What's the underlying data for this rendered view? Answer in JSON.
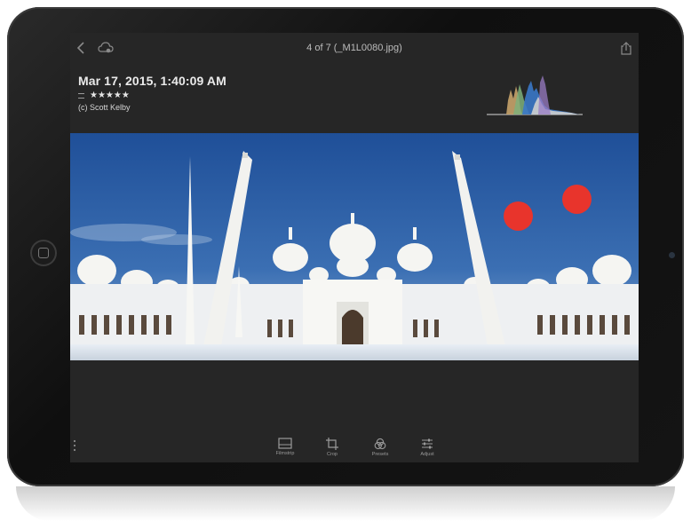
{
  "viewer": {
    "title": "4 of 7 (_M1L0080.jpg)"
  },
  "photo_info": {
    "date": "Mar 17, 2015, 1:40:09 AM",
    "stars": "★★★★★",
    "copyright": "(c) Scott Kelby"
  },
  "toolbar": {
    "filmstrip_label": "Filmstrip",
    "crop_label": "Crop",
    "presets_label": "Presets",
    "adjust_label": "Adjust"
  },
  "icons": {
    "back": "chevron-left-icon",
    "cloud": "cloud-icon",
    "share": "share-icon",
    "more": "more-icon",
    "filmstrip": "filmstrip-icon",
    "crop": "crop-icon",
    "presets": "presets-icon",
    "adjust": "sliders-icon"
  },
  "colors": {
    "app_background": "#262626",
    "annotation_dot": "#e8342c",
    "sky": "#2f5fa5"
  }
}
